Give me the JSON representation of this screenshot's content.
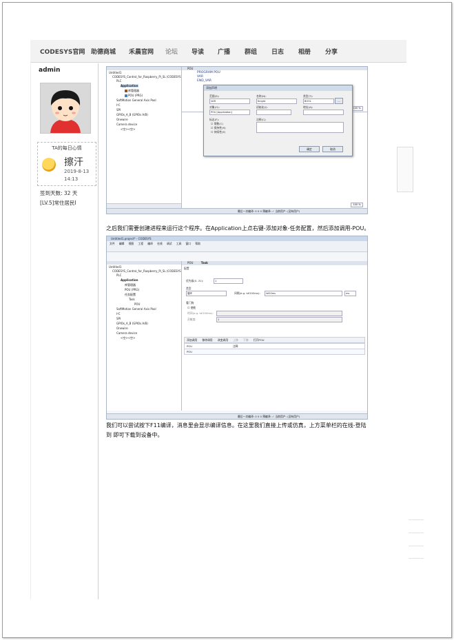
{
  "nav": {
    "items": [
      "CODESYS官网",
      "助德商城",
      "禾晨官网",
      "论坛",
      "导读",
      "广播",
      "群组",
      "日志",
      "相册",
      "分享"
    ]
  },
  "sidebar": {
    "username": "admin",
    "mood": {
      "title": "TA的每日心情",
      "text": "擦汗",
      "date": "2019-8-13",
      "time": "14:13"
    },
    "sign_days": "签到天数: 32 天",
    "level": "[LV.5]常住居民I"
  },
  "shot1": {
    "tree": [
      "Untitled1",
      "CODESYS_Control_for_Raspberry_Pi_SL (CODESYS",
      "PLC",
      "Application",
      "库管理器",
      "POU (PRG)",
      "SoftMotion General Axis Pool",
      "I²C",
      "SPI",
      "GPIOs_A_B (GPIOs A/B)",
      "Onewire",
      "Camera device",
      "<空><空>"
    ],
    "code_tab": "POU",
    "code_lines": [
      "PROGRAM POU",
      "VAR",
      "END_VAR"
    ],
    "zoom1": "100 %",
    "zoom2": "100 %",
    "dialog": {
      "title": "添加声明",
      "scope_label": "范围(S):",
      "scope_value": "VAR",
      "name_label": "名称(N):",
      "name_value": "Knight",
      "type_label": "类型(T):",
      "type_value": "BOOL",
      "object_label": "对象(O):",
      "object_value": "POU [Application]",
      "init_label": "初始化(I):",
      "addr_label": "地址(A):",
      "flags_label": "标志(F):",
      "flags": [
        "常数(C)",
        "保持性(R)",
        "持续性(E)"
      ],
      "comment_label": "注释(C):",
      "ok": "确定",
      "cancel": "取消"
    },
    "status": "最后一次编译: 0 0 0   预编译: ✓   当前用户: (没有用户)"
  },
  "para1": "之后我们需要创建进程来运行这个程序。在Application上点右键-添加对象-任务配置，然后添加调用-POU。",
  "shot2": {
    "window_title": "Untitled1.project* - CODESYS",
    "menu": [
      "文件",
      "编辑",
      "视图",
      "工程",
      "编译",
      "在线",
      "调试",
      "工具",
      "窗口",
      "帮助"
    ],
    "tree": [
      "Untitled1",
      "CODESYS_Control_for_Raspberry_Pi_SL (CODESYS",
      "PLC",
      "Application",
      "库管理器",
      "POU (PRG)",
      "任务配置",
      "Task",
      "POU",
      "SoftMotion General Axis Pool",
      "I²C",
      "SPI",
      "GPIOs_A_B (GPIOs A/B)",
      "Onewire",
      "Camera device",
      "<空><空>"
    ],
    "tabs": [
      "POU",
      "Task"
    ],
    "config_tab": "配置",
    "priority_label": "优先级(0..31):",
    "priority_value": "1",
    "type_label": "类型",
    "type_value": "循环",
    "interval_label": "间隔(e.g. t#200ms):",
    "interval_value": "t#20ms",
    "interval_unit": "ms",
    "watchdog_label": "看门狗",
    "enable_label": "使能",
    "time_label": "时间(e.g. t#200ms):",
    "sens_label": "灵敏度:",
    "sens_value": "1",
    "toolbar": [
      "添加调用",
      "移除调用",
      "改变调用",
      "上移",
      "下移",
      "打开POU"
    ],
    "table_headers": [
      "POU",
      "注释"
    ],
    "table_rows": [
      [
        "POU",
        ""
      ]
    ],
    "status": "最后一次编译: 0 0 0   预编译: ✓   当前用户: (没有用户)"
  },
  "para2_line1": "我们可以尝试按下F11编译，消息里会显示编译信息。在这里我们直接上传或仿真，上方菜单栏的在线-登陆",
  "para2_line2": "到 即可下载到设备中。"
}
